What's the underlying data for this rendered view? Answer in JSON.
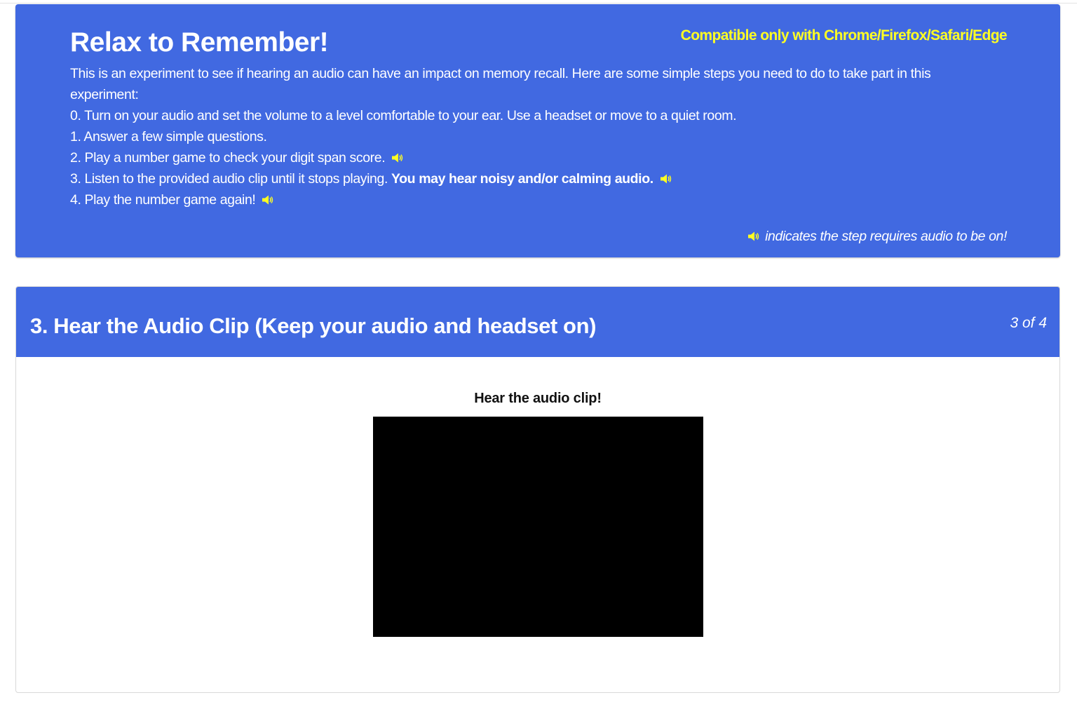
{
  "intro": {
    "title": "Relax to Remember!",
    "compatibility": "Compatible only with Chrome/Firefox/Safari/Edge",
    "description": "This is an experiment to see if hearing an audio can have an impact on memory recall. Here are some simple steps you need to do to take part in this experiment:",
    "steps": [
      {
        "text": "0. Turn on your audio and set the volume to a level comfortable to your ear. Use a headset or move to a quiet room."
      },
      {
        "text": "1. Answer a few simple questions."
      },
      {
        "text": "2. Play a number game to check your digit span score."
      },
      {
        "text": "3. Listen to the provided audio clip until it stops playing.",
        "bold": "You may hear noisy and/or calming audio."
      },
      {
        "text": "4. Play the number game again!"
      }
    ],
    "legend": "indicates the step requires audio to be on!"
  },
  "step": {
    "title": "3. Hear the Audio Clip (Keep your audio and headset on)",
    "counter": "3 of 4",
    "caption": "Hear the audio clip!"
  },
  "colors": {
    "panel_blue": "#4169e1",
    "highlight_yellow": "#ffff22",
    "video_background": "#000000"
  },
  "icons": {
    "audio_required": "speaker-icon"
  }
}
